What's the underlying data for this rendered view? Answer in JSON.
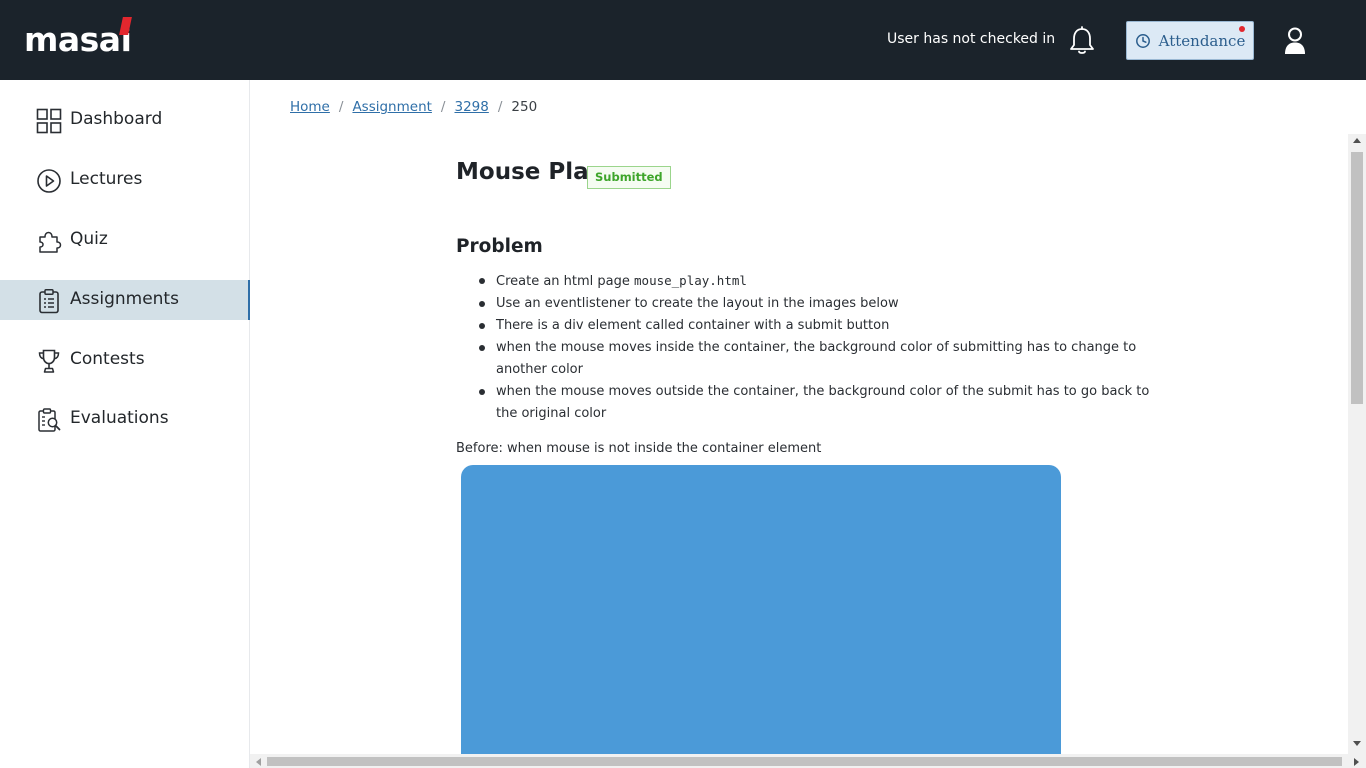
{
  "header": {
    "logo_text": "masa",
    "logo_i": "i",
    "checkin_status": "User has not checked in",
    "attendance_label": "Attendance",
    "colors": {
      "bar": "#1b232b",
      "accent_red": "#e2272e",
      "attendance_bg": "#dce9f5"
    }
  },
  "sidebar": {
    "items": [
      {
        "label": "Dashboard",
        "icon": "dashboard-grid-icon"
      },
      {
        "label": "Lectures",
        "icon": "play-circle-icon"
      },
      {
        "label": "Quiz",
        "icon": "puzzle-icon"
      },
      {
        "label": "Assignments",
        "icon": "clipboard-icon",
        "active": true
      },
      {
        "label": "Contests",
        "icon": "trophy-icon"
      },
      {
        "label": "Evaluations",
        "icon": "evaluation-search-icon"
      }
    ]
  },
  "breadcrumb": {
    "items": [
      "Home",
      "Assignment",
      "3298"
    ],
    "current": "250",
    "separator": "/"
  },
  "assignment": {
    "title": "Mouse Play",
    "status": "Submitted",
    "problem_heading": "Problem",
    "bullets": [
      {
        "text": "Create an html page ",
        "code": "mouse_play.html"
      },
      {
        "text": "Use an eventlistener to create the layout in the images below"
      },
      {
        "text": "There is a div element called container with a submit button"
      },
      {
        "text": "when the mouse moves inside the container, the background color of submitting has to change to another color"
      },
      {
        "text": "when the mouse moves outside the container, the background color of the submit has to go back to the original color"
      }
    ],
    "before_caption": "Before: when mouse is not inside the container element",
    "demo_color": "#4b9ad8"
  }
}
